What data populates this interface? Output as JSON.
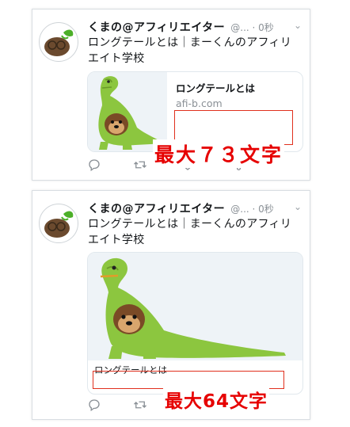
{
  "tweets": [
    {
      "name": "くまの@アフィリエイター",
      "handle": "@... · 0秒",
      "text": "ロングテールとは｜まーくんのアフィリエイト学校",
      "card": {
        "title": "ロングテールとは",
        "domain": "afi-b.com"
      }
    },
    {
      "name": "くまの@アフィリエイター",
      "handle": "@... · 0秒",
      "text": "ロングテールとは｜まーくんのアフィリエイト学校",
      "card": {
        "title": "ロングテールとは"
      }
    }
  ],
  "notes": {
    "note1": "最大７３文字",
    "note2": "最大64文字"
  },
  "colors": {
    "annotation_red": "#e60000",
    "dino_green": "#8cc63f",
    "icon_grey": "#8a9096"
  },
  "icons": [
    "reply-icon",
    "retweet-icon",
    "like-icon",
    "share-icon",
    "chevron-down-icon"
  ]
}
